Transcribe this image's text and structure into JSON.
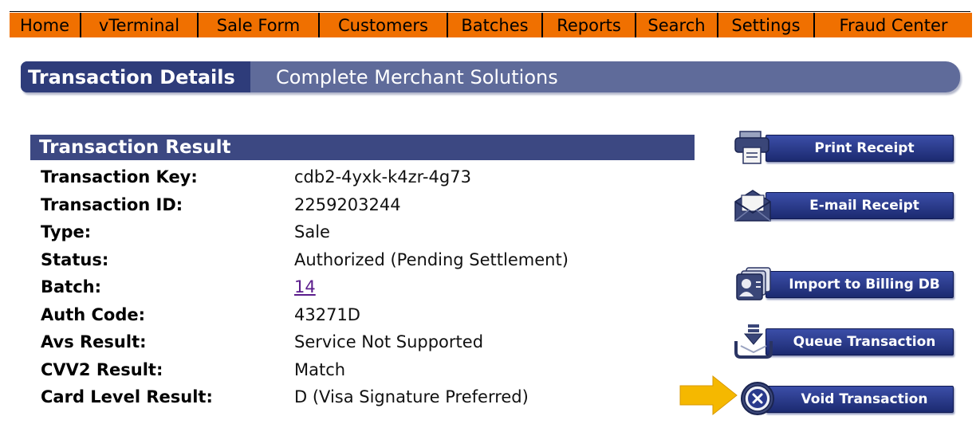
{
  "nav": {
    "items": [
      {
        "label": "Home"
      },
      {
        "label": "vTerminal"
      },
      {
        "label": "Sale Form"
      },
      {
        "label": "Customers"
      },
      {
        "label": "Batches"
      },
      {
        "label": "Reports"
      },
      {
        "label": "Search"
      },
      {
        "label": "Settings"
      },
      {
        "label": "Fraud Center"
      }
    ]
  },
  "header": {
    "title": "Transaction Details",
    "subtitle": "Complete Merchant Solutions"
  },
  "result": {
    "heading": "Transaction Result",
    "rows": [
      {
        "label": "Transaction Key:",
        "value": "cdb2-4yxk-k4zr-4g73"
      },
      {
        "label": "Transaction ID:",
        "value": "2259203244"
      },
      {
        "label": "Type:",
        "value": "Sale"
      },
      {
        "label": "Status:",
        "value": "Authorized (Pending Settlement)"
      },
      {
        "label": "Batch:",
        "value": "14"
      },
      {
        "label": "Auth Code:",
        "value": "43271D"
      },
      {
        "label": "Avs Result:",
        "value": "Service Not Supported"
      },
      {
        "label": "CVV2 Result:",
        "value": "Match"
      },
      {
        "label": "Card Level Result:",
        "value": "D (Visa Signature Preferred)"
      }
    ]
  },
  "actions": {
    "print_receipt": "Print Receipt",
    "email_receipt": "E-mail Receipt",
    "import_billing": "Import to Billing DB",
    "queue_transaction": "Queue Transaction",
    "void_transaction": "Void Transaction"
  },
  "colors": {
    "nav_orange": "#f07000",
    "header_dark": "#2e3c7a",
    "header_light": "#5f6b9a",
    "button_blue": "#2a3a8c",
    "arrow_yellow": "#f5b800"
  }
}
